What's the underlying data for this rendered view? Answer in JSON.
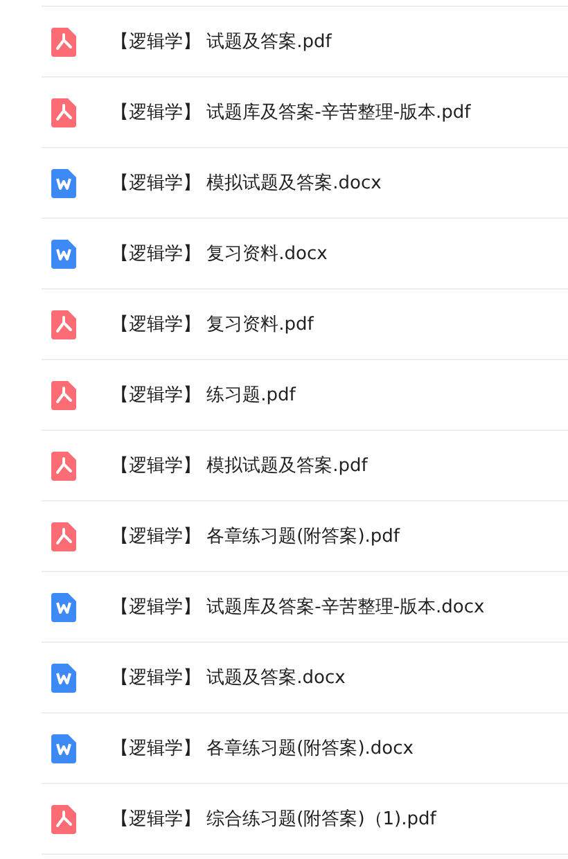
{
  "files": [
    {
      "kind": "pdf",
      "name": "【逻辑学】 试题及答案.pdf"
    },
    {
      "kind": "pdf",
      "name": "【逻辑学】 试题库及答案-辛苦整理-版本.pdf"
    },
    {
      "kind": "docx",
      "name": "【逻辑学】 模拟试题及答案.docx"
    },
    {
      "kind": "docx",
      "name": "【逻辑学】 复习资料.docx"
    },
    {
      "kind": "pdf",
      "name": "【逻辑学】 复习资料.pdf"
    },
    {
      "kind": "pdf",
      "name": "【逻辑学】 练习题.pdf"
    },
    {
      "kind": "pdf",
      "name": "【逻辑学】 模拟试题及答案.pdf"
    },
    {
      "kind": "pdf",
      "name": "【逻辑学】 各章练习题(附答案).pdf"
    },
    {
      "kind": "docx",
      "name": "【逻辑学】 试题库及答案-辛苦整理-版本.docx"
    },
    {
      "kind": "docx",
      "name": "【逻辑学】 试题及答案.docx"
    },
    {
      "kind": "docx",
      "name": "【逻辑学】 各章练习题(附答案).docx"
    },
    {
      "kind": "pdf",
      "name": "【逻辑学】 综合练习题(附答案)（1).pdf"
    }
  ]
}
